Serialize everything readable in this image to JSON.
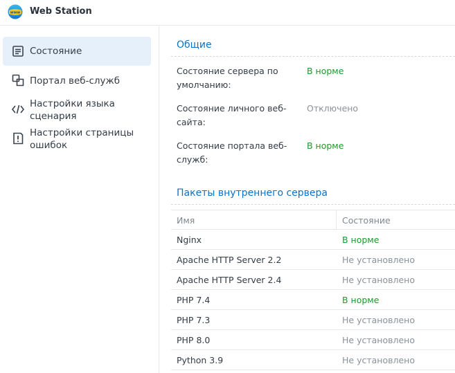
{
  "app": {
    "title": "Web Station",
    "logo_icon": "www-globe-icon"
  },
  "colors": {
    "accent": "#0a72c8",
    "ok": "#1c9b2d",
    "muted": "#8a9199",
    "active_bg": "#e6f0fa"
  },
  "sidebar": {
    "items": [
      {
        "label": "Состояние",
        "icon": "status-list-icon",
        "active": true
      },
      {
        "label": "Портал веб-служб",
        "icon": "portal-icon",
        "active": false
      },
      {
        "label": "Настройки языка сценария",
        "icon": "code-icon",
        "active": false
      },
      {
        "label": "Настройки страницы ошибок",
        "icon": "error-page-icon",
        "active": false
      }
    ]
  },
  "general": {
    "title": "Общие",
    "rows": [
      {
        "key": "Состояние сервера по умолчанию:",
        "value": "В норме",
        "status": "ok"
      },
      {
        "key": "Состояние личного веб-сайта:",
        "value": "Отключено",
        "status": "muted"
      },
      {
        "key": "Состояние портала веб-служб:",
        "value": "В норме",
        "status": "ok"
      }
    ]
  },
  "packages": {
    "title": "Пакеты внутреннего сервера",
    "columns": [
      "Имя",
      "Состояние"
    ],
    "rows": [
      {
        "name": "Nginx",
        "status": "В норме",
        "state": "ok"
      },
      {
        "name": "Apache HTTP Server 2.2",
        "status": "Не установлено",
        "state": "muted"
      },
      {
        "name": "Apache HTTP Server 2.4",
        "status": "Не установлено",
        "state": "muted"
      },
      {
        "name": "PHP 7.4",
        "status": "В норме",
        "state": "ok"
      },
      {
        "name": "PHP 7.3",
        "status": "Не установлено",
        "state": "muted"
      },
      {
        "name": "PHP 8.0",
        "status": "Не установлено",
        "state": "muted"
      },
      {
        "name": "Python 3.9",
        "status": "Не установлено",
        "state": "muted"
      }
    ]
  }
}
